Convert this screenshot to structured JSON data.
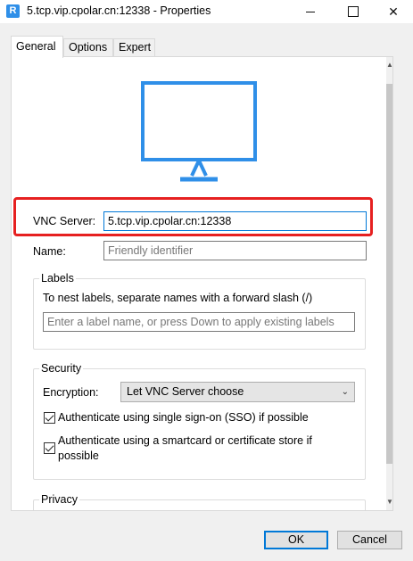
{
  "window": {
    "title": "5.tcp.vip.cpolar.cn:12338 - Properties",
    "app_icon_glyph": "R",
    "minimize_icon": "minimize-icon",
    "maximize_icon": "maximize-icon",
    "close_glyph": "✕"
  },
  "tabs": [
    {
      "label": "General",
      "active": true
    },
    {
      "label": "Options",
      "active": false
    },
    {
      "label": "Expert",
      "active": false
    }
  ],
  "general": {
    "vnc_server_label": "VNC Server:",
    "vnc_server_value": "5.tcp.vip.cpolar.cn:12338",
    "name_label": "Name:",
    "name_placeholder": "Friendly identifier",
    "labels_group_title": "Labels",
    "labels_hint": "To nest labels, separate names with a forward slash (/)",
    "labels_placeholder": "Enter a label name, or press Down to apply existing labels",
    "security_group_title": "Security",
    "encryption_label": "Encryption:",
    "encryption_value": "Let VNC Server choose",
    "sso_label": "Authenticate using single sign-on (SSO) if possible",
    "smartcard_label_line1": "Authenticate using a smartcard or certificate store if",
    "smartcard_label_line2": "possible",
    "privacy_group_title": "Privacy"
  },
  "buttons": {
    "ok": "OK",
    "cancel": "Cancel"
  },
  "colors": {
    "monitor_blue": "#2f8fe8",
    "highlight_red": "#e62020",
    "focus_blue": "#0078d7"
  },
  "icons": {
    "monitor": "monitor-icon",
    "dropdown": "chevron-down-icon",
    "scroll_up": "scroll-up-arrow",
    "scroll_down": "scroll-down-arrow"
  }
}
